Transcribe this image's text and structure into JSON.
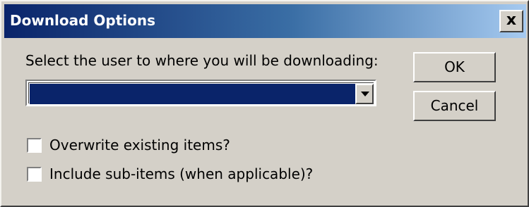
{
  "window": {
    "title": "Download Options",
    "close_label": "x"
  },
  "form": {
    "prompt": "Select the user to where you will be downloading:",
    "user_select": {
      "selected_value": ""
    },
    "checkboxes": [
      {
        "label": "Overwrite existing items?",
        "checked": false
      },
      {
        "label": "Include sub-items (when applicable)?",
        "checked": false
      }
    ]
  },
  "buttons": {
    "ok_label": "OK",
    "cancel_label": "Cancel"
  },
  "colors": {
    "titlebar_start": "#0a246a",
    "titlebar_end": "#a6caf0",
    "dialog_face": "#d4d0c8",
    "selection": "#0a246a"
  }
}
